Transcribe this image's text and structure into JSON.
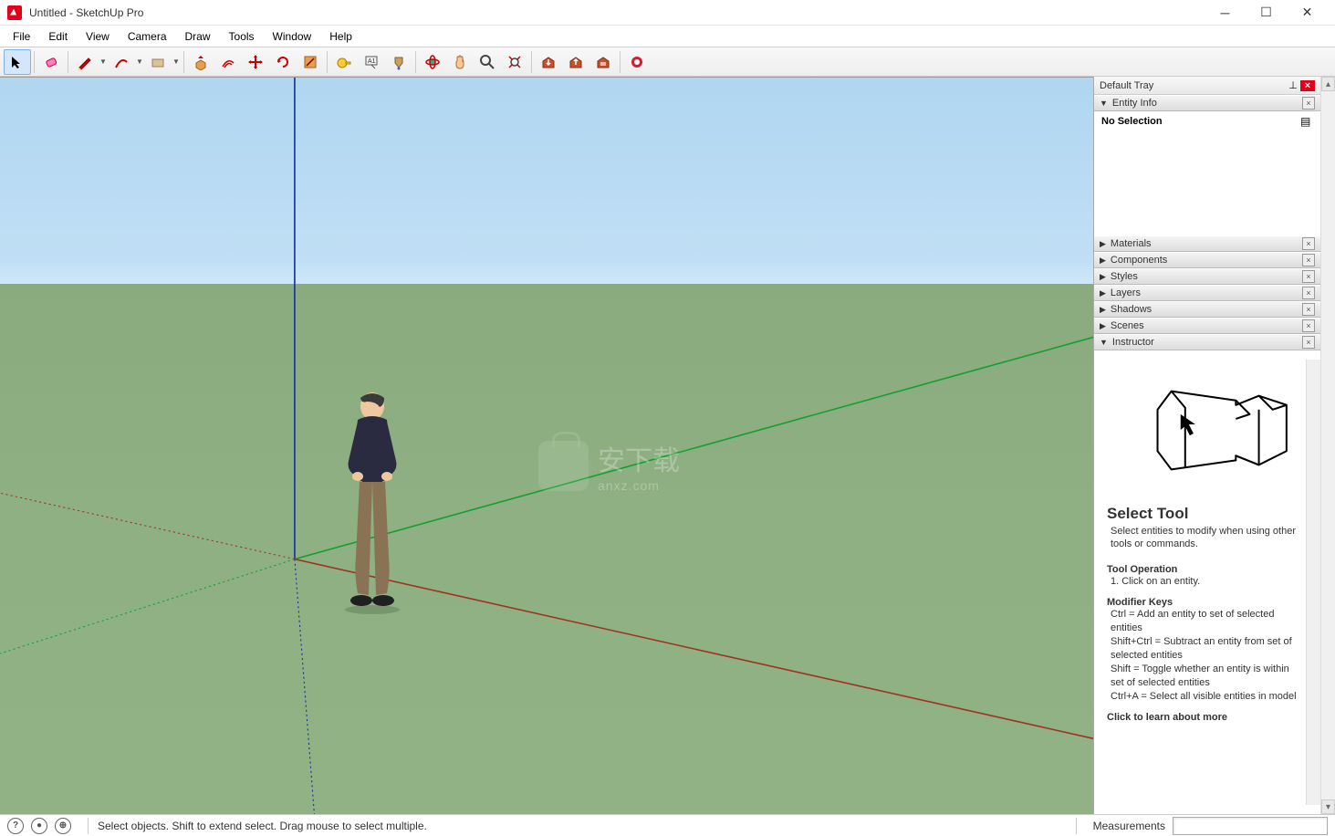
{
  "window": {
    "title": "Untitled - SketchUp Pro"
  },
  "menus": [
    "File",
    "Edit",
    "View",
    "Camera",
    "Draw",
    "Tools",
    "Window",
    "Help"
  ],
  "toolbar_icons": [
    "select",
    "eraser",
    "pencil",
    "arc",
    "rectangle",
    "pushpull",
    "offset",
    "move",
    "rotate",
    "scale",
    "tape",
    "text",
    "paint",
    "orbit",
    "pan",
    "zoom",
    "zoom-extents",
    "warehouse-get",
    "warehouse-share",
    "warehouse-delete",
    "extension"
  ],
  "tray": {
    "title": "Default Tray",
    "entity_info": {
      "label": "Entity Info",
      "selection": "No Selection"
    },
    "panels": [
      "Materials",
      "Components",
      "Styles",
      "Layers",
      "Shadows",
      "Scenes"
    ],
    "instructor": {
      "label": "Instructor",
      "tool_name": "Select Tool",
      "tool_desc": "Select entities to modify when using other tools or commands.",
      "op_title": "Tool Operation",
      "op_text": "1. Click on an entity.",
      "mod_title": "Modifier Keys",
      "mod_text": "Ctrl = Add an entity to set of selected entities\nShift+Ctrl = Subtract an entity from set of selected entities\nShift = Toggle whether an entity is within set of selected entities\nCtrl+A = Select all visible entities in model",
      "more_link": "Click to learn about more"
    }
  },
  "statusbar": {
    "hint": "Select objects. Shift to extend select. Drag mouse to select multiple.",
    "measurements_label": "Measurements"
  },
  "watermark": {
    "text_main": "安下载",
    "text_sub": "anxz.com"
  }
}
